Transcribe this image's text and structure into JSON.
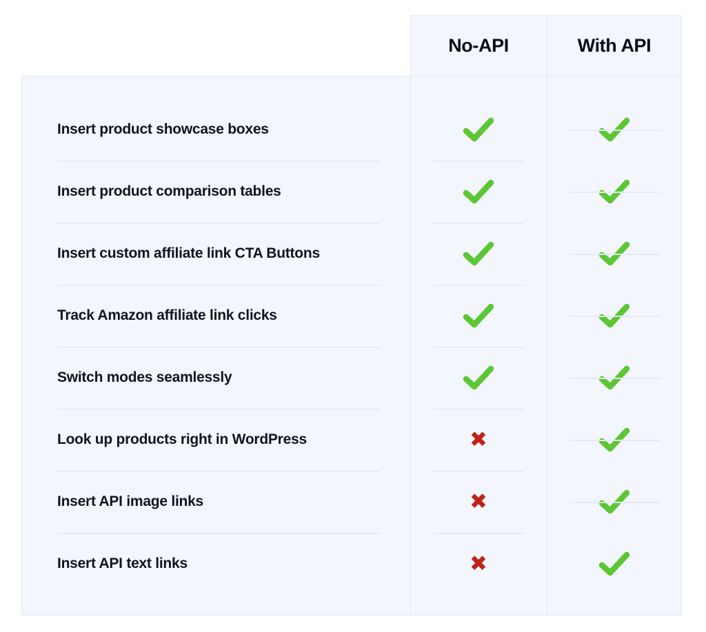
{
  "table": {
    "title_column_header": "",
    "column_headers": [
      "No-API",
      "With API"
    ],
    "icons": {
      "yes": "check-icon",
      "no": "cross-icon"
    },
    "colors": {
      "panel_background": "#f3f6fd",
      "page_background": "#ffffff",
      "border": "#e4e8f4",
      "divider": "#e6eaf4",
      "check_green": "#5cc633",
      "cross_red": "#bf2318",
      "text": "#12131f",
      "header_text": "#0b0c16"
    },
    "rows": [
      {
        "label": "Insert product showcase boxes",
        "values": [
          "yes",
          "yes"
        ]
      },
      {
        "label": "Insert product comparison tables",
        "values": [
          "yes",
          "yes"
        ]
      },
      {
        "label": "Insert custom affiliate link CTA Buttons",
        "values": [
          "yes",
          "yes"
        ]
      },
      {
        "label": "Track Amazon affiliate link clicks",
        "values": [
          "yes",
          "yes"
        ]
      },
      {
        "label": "Switch modes seamlessly",
        "values": [
          "yes",
          "yes"
        ]
      },
      {
        "label": "Look up products right in WordPress",
        "values": [
          "no",
          "yes"
        ]
      },
      {
        "label": "Insert API image links",
        "values": [
          "no",
          "yes"
        ]
      },
      {
        "label": "Insert API text links",
        "values": [
          "no",
          "yes"
        ]
      }
    ]
  }
}
